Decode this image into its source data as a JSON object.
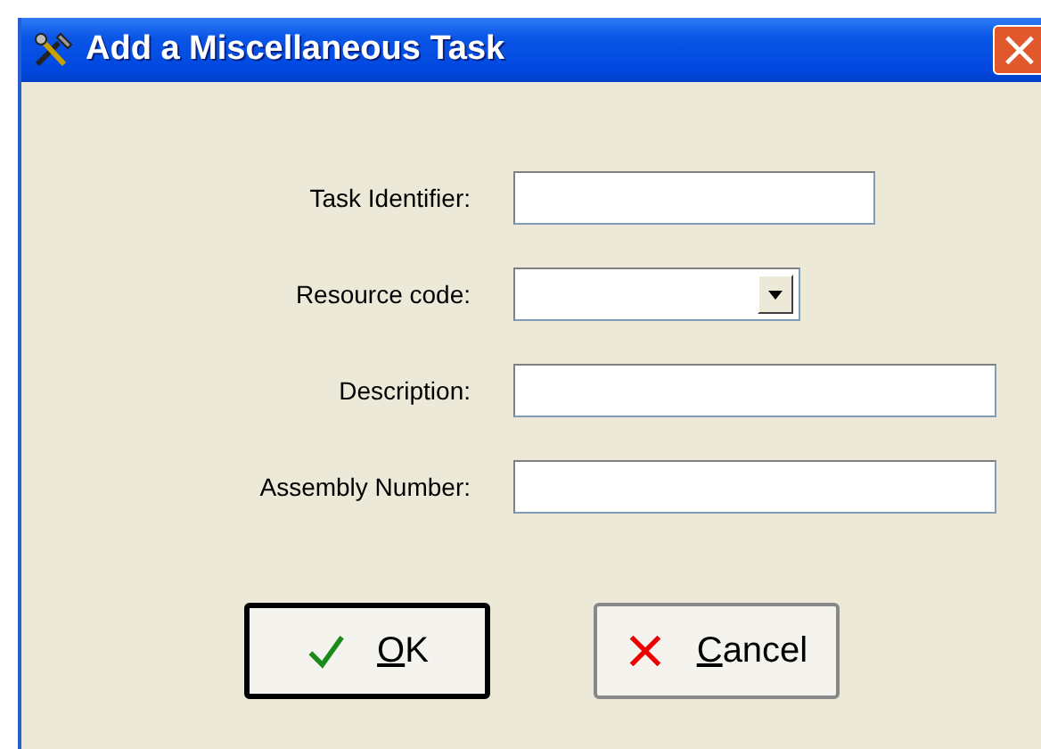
{
  "window": {
    "title": "Add a Miscellaneous Task",
    "close_button": "×"
  },
  "fields": [
    {
      "label": "Task Identifier:",
      "kind": "text",
      "wide": false
    },
    {
      "label": "Resource code:",
      "kind": "combo",
      "wide": false
    },
    {
      "label": "Description:",
      "kind": "text",
      "wide": true
    },
    {
      "label": "Assembly Number:",
      "kind": "text",
      "wide": true
    }
  ],
  "buttons": [
    {
      "label": "OK",
      "kind": "ok",
      "default": true,
      "underline_first": true
    },
    {
      "label": "Cancel",
      "kind": "cancel",
      "default": false,
      "underline_first": true
    }
  ]
}
